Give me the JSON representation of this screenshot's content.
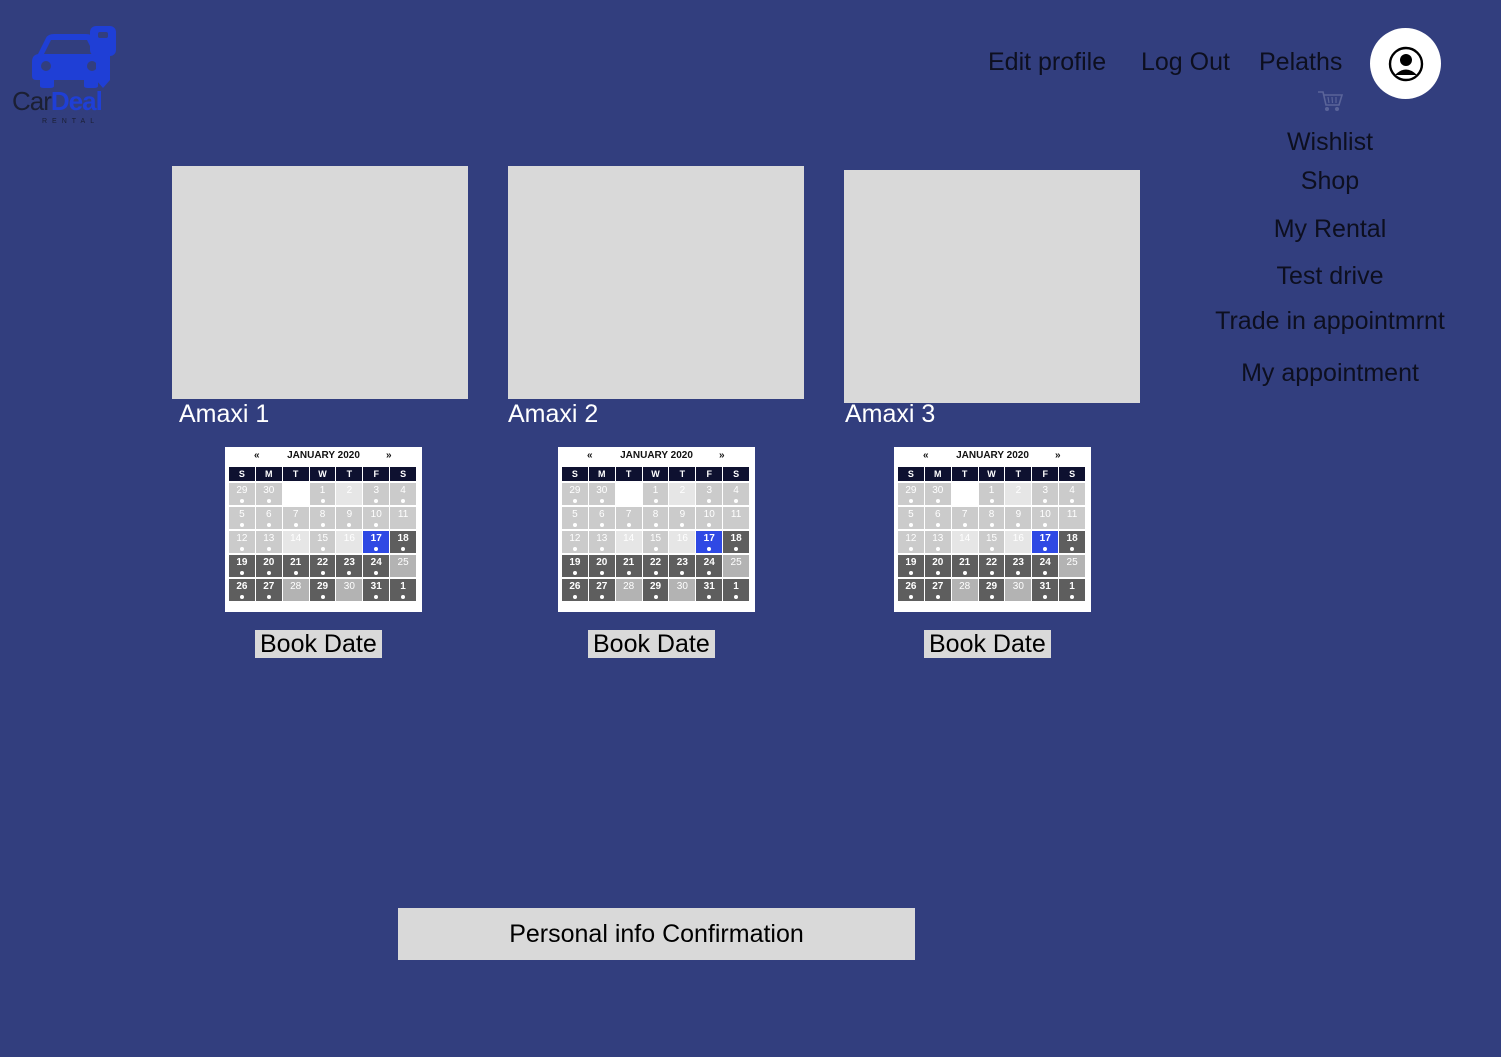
{
  "logo": {
    "name_part1": "Car",
    "name_part2": "Deal",
    "subtitle": "RENTAL"
  },
  "header": {
    "edit_profile": "Edit profile",
    "log_out": "Log Out",
    "username": "Pelaths"
  },
  "side_menu": {
    "items": [
      "Wishlist",
      "Shop",
      "My Rental",
      "Test drive",
      "Trade in appointmrnt",
      "My appointment"
    ]
  },
  "cars": [
    {
      "name": "Amaxi 1",
      "book_label": "Book Date"
    },
    {
      "name": "Amaxi 2",
      "book_label": "Book Date"
    },
    {
      "name": "Amaxi 3",
      "book_label": "Book Date"
    }
  ],
  "calendar": {
    "month": "JANUARY 2020",
    "prev": "«",
    "next": "»",
    "weekdays": [
      "S",
      "M",
      "T",
      "W",
      "T",
      "F",
      "S"
    ],
    "weeks": [
      [
        [
          "29",
          "light",
          1
        ],
        [
          "30",
          "light",
          1
        ],
        [
          "",
          "white",
          0
        ],
        [
          "1",
          "light",
          1
        ],
        [
          "2",
          "pale",
          0
        ],
        [
          "3",
          "light",
          1
        ],
        [
          "4",
          "light",
          1
        ]
      ],
      [
        [
          "5",
          "light",
          1
        ],
        [
          "6",
          "light",
          1
        ],
        [
          "7",
          "light",
          1
        ],
        [
          "8",
          "light",
          1
        ],
        [
          "9",
          "light",
          1
        ],
        [
          "10",
          "light",
          1
        ],
        [
          "11",
          "light",
          0
        ]
      ],
      [
        [
          "12",
          "light",
          1
        ],
        [
          "13",
          "light",
          1
        ],
        [
          "14",
          "pale",
          0
        ],
        [
          "15",
          "light",
          1
        ],
        [
          "16",
          "pale",
          0
        ],
        [
          "17",
          "sel",
          1
        ],
        [
          "18",
          "dark",
          1
        ]
      ],
      [
        [
          "19",
          "dark",
          1
        ],
        [
          "20",
          "dark",
          1
        ],
        [
          "21",
          "dark",
          1
        ],
        [
          "22",
          "dark",
          1
        ],
        [
          "23",
          "dark",
          1
        ],
        [
          "24",
          "dark",
          1
        ],
        [
          "25",
          "mid",
          0
        ]
      ],
      [
        [
          "26",
          "dark",
          1
        ],
        [
          "27",
          "dark",
          1
        ],
        [
          "28",
          "mid",
          0
        ],
        [
          "29",
          "dark",
          1
        ],
        [
          "30",
          "mid",
          0
        ],
        [
          "31",
          "dark",
          1
        ],
        [
          "1",
          "dark",
          1
        ]
      ]
    ]
  },
  "confirm_label": "Personal info Confirmation",
  "icons": {
    "cart": "cart-icon",
    "avatar": "user-circle-icon",
    "logo": "car-key-logo-icon"
  },
  "colors": {
    "background": "#323e7e",
    "accent": "#2f49e4",
    "placeholder": "#d9d9d9"
  }
}
